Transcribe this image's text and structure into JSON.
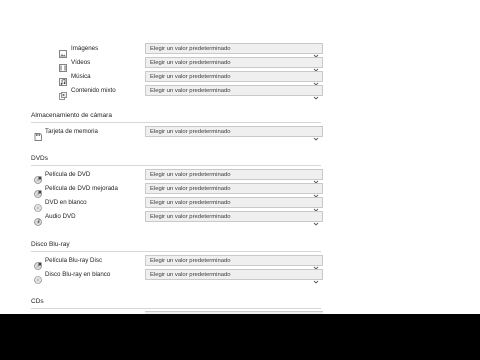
{
  "media": {
    "items": [
      {
        "label": "Imágenes",
        "value": "Elegir un valor predeterminado",
        "icon": "image-icon"
      },
      {
        "label": "Vídeos",
        "value": "Elegir un valor predeterminado",
        "icon": "video-icon"
      },
      {
        "label": "Música",
        "value": "Elegir un valor predeterminado",
        "icon": "music-icon"
      },
      {
        "label": "Contenido mixto",
        "value": "Elegir un valor predeterminado",
        "icon": "mixed-content-icon"
      }
    ]
  },
  "camera": {
    "title": "Almacenamiento de cámara",
    "items": [
      {
        "label": "Tarjeta de memoria",
        "value": "Elegir un valor predeterminado",
        "icon": "memory-card-icon"
      }
    ]
  },
  "dvds": {
    "title": "DVDs",
    "items": [
      {
        "label": "Película de DVD",
        "value": "Elegir un valor predeterminado",
        "icon": "dvd-movie-icon"
      },
      {
        "label": "Película de DVD mejorada",
        "value": "Elegir un valor predeterminado",
        "icon": "dvd-enhanced-icon"
      },
      {
        "label": "DVD en blanco",
        "value": "Elegir un valor predeterminado",
        "icon": "blank-disc-icon"
      },
      {
        "label": "Audio DVD",
        "value": "Elegir un valor predeterminado",
        "icon": "audio-dvd-icon"
      }
    ]
  },
  "bluray": {
    "title": "Disco Blu-ray",
    "items": [
      {
        "label": "Película Blu-ray Disc",
        "value": "Elegir un valor predeterminado",
        "icon": "bluray-movie-icon"
      },
      {
        "label": "Disco Blu-ray en blanco",
        "value": "Elegir un valor predeterminado",
        "icon": "blank-disc-icon"
      }
    ]
  },
  "cds": {
    "title": "CDs"
  }
}
